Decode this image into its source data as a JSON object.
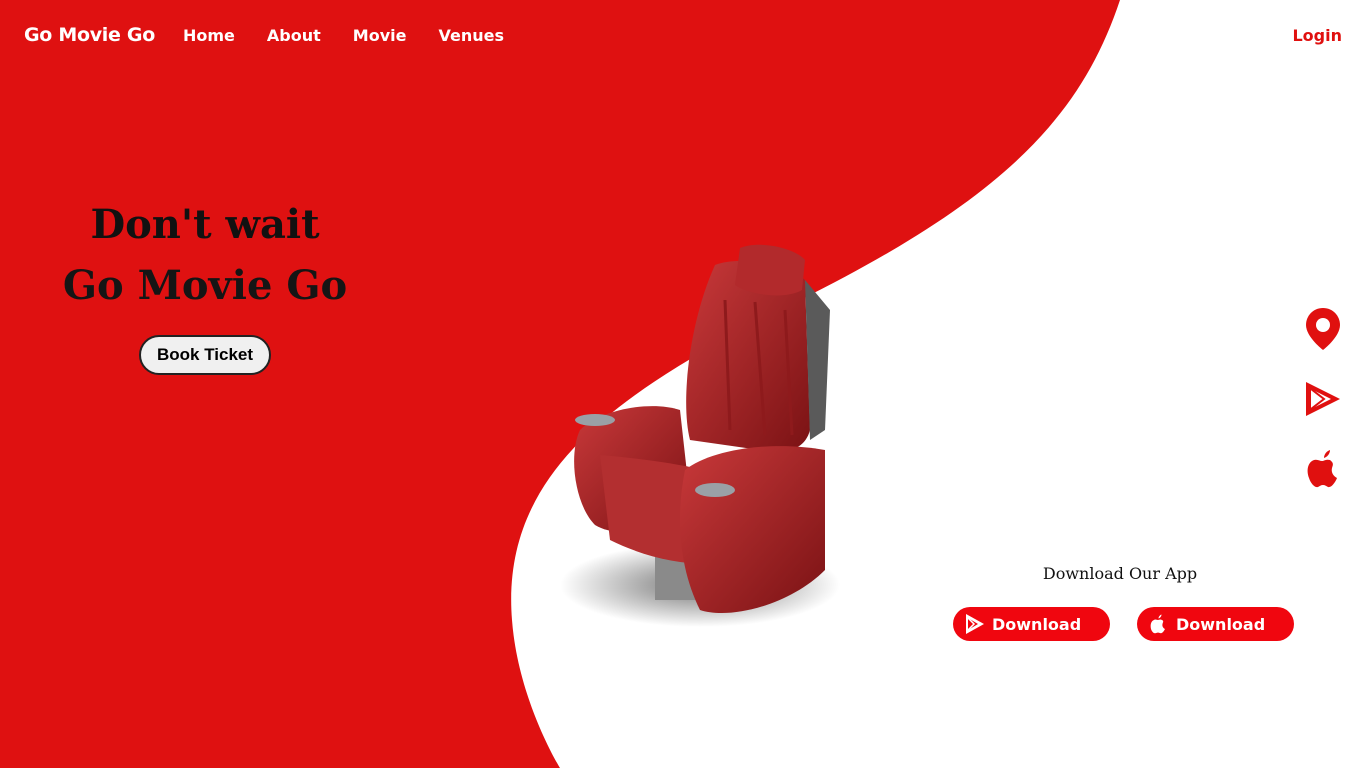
{
  "nav": {
    "brand": "Go Movie Go",
    "links": [
      "Home",
      "About",
      "Movie",
      "Venues"
    ],
    "login": "Login"
  },
  "hero": {
    "line1": "Don't wait",
    "line2": "Go Movie Go",
    "cta": "Book Ticket"
  },
  "side_icons": [
    "location-pin-icon",
    "google-play-icon",
    "apple-icon"
  ],
  "download": {
    "title": "Download Our App",
    "buttons": [
      {
        "label": "Download",
        "icon": "google-play-icon"
      },
      {
        "label": "Download",
        "icon": "apple-icon"
      }
    ]
  },
  "colors": {
    "primary_red": "#df1111",
    "button_red": "#f0060f",
    "background": "#ffffff"
  }
}
